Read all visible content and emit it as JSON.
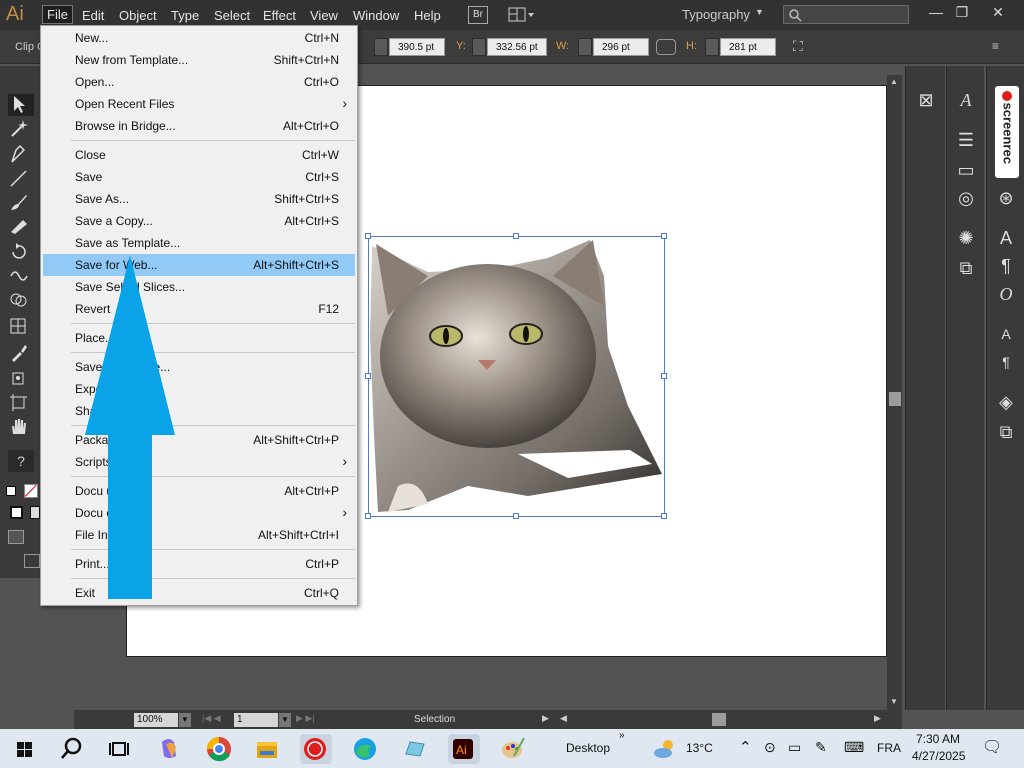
{
  "menubar": {
    "logo": "Ai",
    "items": [
      "File",
      "Edit",
      "Object",
      "Type",
      "Select",
      "Effect",
      "View",
      "Window",
      "Help"
    ],
    "bridge_button": "Br",
    "workspace": "Typography"
  },
  "control_bar": {
    "left_label": "Clip G",
    "x_label": "X:",
    "x_value": "390.5 pt",
    "y_label": "Y:",
    "y_value": "332.56 pt",
    "w_label": "W:",
    "w_value": "296 pt",
    "h_label": "H:",
    "h_value": "281 pt"
  },
  "file_menu": {
    "items": [
      {
        "label": "New...",
        "shortcut": "Ctrl+N"
      },
      {
        "label": "New from Template...",
        "shortcut": "Shift+Ctrl+N"
      },
      {
        "label": "Open...",
        "shortcut": "Ctrl+O"
      },
      {
        "label": "Open Recent Files",
        "shortcut": ""
      },
      {
        "label": "Browse in Bridge...",
        "shortcut": "Alt+Ctrl+O"
      },
      {
        "label": "Close",
        "shortcut": "Ctrl+W"
      },
      {
        "label": "Save",
        "shortcut": "Ctrl+S"
      },
      {
        "label": "Save As...",
        "shortcut": "Shift+Ctrl+S"
      },
      {
        "label": "Save a Copy...",
        "shortcut": "Alt+Ctrl+S"
      },
      {
        "label": "Save as Template...",
        "shortcut": ""
      },
      {
        "label": "Save for Web...",
        "shortcut": "Alt+Shift+Ctrl+S"
      },
      {
        "label": "Save Sele   d Slices...",
        "shortcut": ""
      },
      {
        "label": "Revert",
        "shortcut": "F12"
      },
      {
        "label": "Place...",
        "shortcut": ""
      },
      {
        "label": "Save f          oft Office...",
        "shortcut": ""
      },
      {
        "label": "Expo",
        "shortcut": ""
      },
      {
        "label": "Sha            ...",
        "shortcut": ""
      },
      {
        "label": "Packa",
        "shortcut": "Alt+Shift+Ctrl+P"
      },
      {
        "label": "Scripts",
        "shortcut": ""
      },
      {
        "label": "Docu           up...",
        "shortcut": "Alt+Ctrl+P"
      },
      {
        "label": "Docu          or Mode",
        "shortcut": ""
      },
      {
        "label": "File Int",
        "shortcut": "Alt+Shift+Ctrl+I"
      },
      {
        "label": "Print...",
        "shortcut": "Ctrl+P"
      },
      {
        "label": "Exit",
        "shortcut": "Ctrl+Q"
      }
    ]
  },
  "panels": {
    "screenrec_label": "screenrec"
  },
  "status_bar": {
    "zoom": "100%",
    "page": "1",
    "tool_status": "Selection"
  },
  "taskbar": {
    "desktop_label": "Desktop",
    "weather": "13°C",
    "language": "FRA",
    "time": "7:30 AM",
    "date": "4/27/2025"
  },
  "colors": {
    "menu_highlight": "#91c9f7",
    "arrow": "#0aa3e8",
    "selection": "#4b7bd6"
  }
}
